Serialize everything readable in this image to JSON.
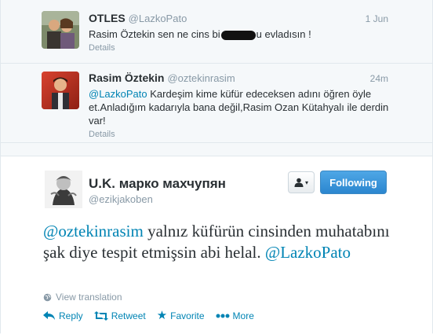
{
  "tweets": [
    {
      "name": "OTLES",
      "handle": "@LazkoPato",
      "time": "1 Jun",
      "text_before": "Rasim Öztekin sen ne cins bi",
      "text_after": "u evladısın !",
      "details": "Details"
    },
    {
      "name": "Rasim Öztekin",
      "handle": "@oztekinrasim",
      "time": "24m",
      "mention": "@LazkoPato",
      "text": " Kardeşim kime küfür edeceksen adını öğren öyle et.Anladığım kadarıyla bana değil,Rasim Ozan Kütahyalı ile derdin var!",
      "details": "Details"
    }
  ],
  "main": {
    "name": "U.K. марко махчупян",
    "handle": "@ezikjakoben",
    "follow_label": "Following",
    "mention1": "@oztekinrasim",
    "text": " yalnız küfürün cinsinden muhatabını şak diye tespit etmişsin abi helal. ",
    "mention2": "@LazkoPato",
    "view_translation": "View translation",
    "actions": {
      "reply": "Reply",
      "retweet": "Retweet",
      "favorite": "Favorite",
      "more": "More"
    }
  }
}
